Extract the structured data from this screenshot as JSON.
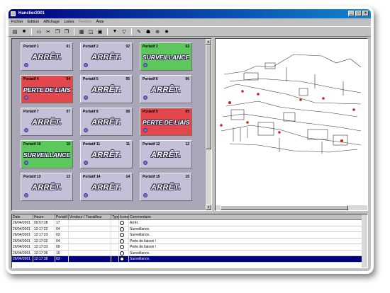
{
  "window": {
    "title": "Hanclier2001",
    "btn_min": "_",
    "btn_max": "□",
    "btn_close": "×"
  },
  "menu": [
    {
      "label": "Fichier",
      "enabled": true
    },
    {
      "label": "Edition",
      "enabled": true
    },
    {
      "label": "Affichage",
      "enabled": true
    },
    {
      "label": "Listes",
      "enabled": true
    },
    {
      "label": "Fenêtre",
      "enabled": false
    },
    {
      "label": "Aide",
      "enabled": true
    }
  ],
  "toolbar_icons": [
    "open-icon",
    "save-icon",
    "print-icon",
    "cut-icon",
    "copy-icon",
    "paste-icon",
    "grid-icon",
    "view-icon",
    "camera-icon",
    "filter-icon",
    "filter-off-icon",
    "tool-icon",
    "network-icon",
    "zoom-icon",
    "alarm-icon"
  ],
  "toolbar_glyphs": [
    "▤",
    "■",
    "▭",
    "✂",
    "❐",
    "❒",
    "▦",
    "◫",
    "▣",
    "▼",
    "▽",
    "✎",
    "☗",
    "⊕",
    "✸"
  ],
  "colors": {
    "idle": "#c4c0d8",
    "lost": "#e2474b",
    "watch": "#5cc75a"
  },
  "tiles": [
    {
      "name": "Portatif 1",
      "num": "01",
      "status": "ARRÊT.",
      "state": "idle"
    },
    {
      "name": "Portatif 2",
      "num": "02",
      "status": "ARRÊT.",
      "state": "idle"
    },
    {
      "name": "Portatif 3",
      "num": "03",
      "status": "SURVEILLANCE.",
      "state": "watch"
    },
    {
      "name": "Portatif 4",
      "num": "04",
      "status": "PERTE DE LIAISON",
      "state": "lost"
    },
    {
      "name": "Portatif 5",
      "num": "05",
      "status": "ARRÊT.",
      "state": "idle"
    },
    {
      "name": "Portatif 6",
      "num": "06",
      "status": "ARRÊT.",
      "state": "idle"
    },
    {
      "name": "Portatif 7",
      "num": "07",
      "status": "ARRÊT.",
      "state": "idle"
    },
    {
      "name": "Portatif 8",
      "num": "08",
      "status": "ARRÊT.",
      "state": "idle"
    },
    {
      "name": "Portatif 9",
      "num": "09",
      "status": "PERTE DE LIAISON",
      "state": "lost"
    },
    {
      "name": "Portatif 10",
      "num": "10",
      "status": "SURVEILLANCE.",
      "state": "watch"
    },
    {
      "name": "Portatif 11",
      "num": "11",
      "status": "ARRÊT.",
      "state": "idle"
    },
    {
      "name": "Portatif 12",
      "num": "12",
      "status": "ARRÊT.",
      "state": "idle"
    },
    {
      "name": "Portatif 13",
      "num": "13",
      "status": "ARRÊT.",
      "state": "idle"
    },
    {
      "name": "Portatif 14",
      "num": "14",
      "status": "ARRÊT.",
      "state": "idle"
    },
    {
      "name": "Portatif 15",
      "num": "15",
      "status": "ARRÊT.",
      "state": "idle"
    }
  ],
  "log": {
    "headers": {
      "date": "Date",
      "heure": "Heure",
      "poste": "Portatif",
      "user": "Vendeur / Travailleur",
      "type": "Type",
      "icone": "Icone",
      "comment": "Commentaire"
    },
    "rows": [
      {
        "date": "26/04/2001",
        "heure": "09:57:28",
        "poste": "17",
        "user": "",
        "comment": "Arrêt.",
        "selected": false
      },
      {
        "date": "26/04/2001",
        "heure": "12:17:22",
        "poste": "04",
        "user": "",
        "comment": "Surveillance.",
        "selected": false
      },
      {
        "date": "26/04/2001",
        "heure": "12:17:23",
        "poste": "03",
        "user": "",
        "comment": "Surveillance.",
        "selected": false
      },
      {
        "date": "26/04/2001",
        "heure": "12:17:32",
        "poste": "04",
        "user": "",
        "comment": "Perte de liaison !",
        "selected": false
      },
      {
        "date": "26/04/2001",
        "heure": "12:17:33",
        "poste": "09",
        "user": "",
        "comment": "Perte de liaison !",
        "selected": false
      },
      {
        "date": "26/04/2001",
        "heure": "12:17:36",
        "poste": "10",
        "user": "",
        "comment": "Surveillance.",
        "selected": false
      },
      {
        "date": "26/04/2001",
        "heure": "12:17:38",
        "poste": "03",
        "user": "",
        "comment": "Surveillance.",
        "selected": true
      }
    ]
  }
}
